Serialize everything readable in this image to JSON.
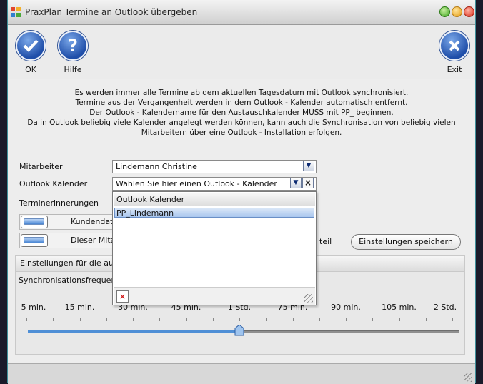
{
  "window": {
    "title": "PraxPlan Termine an Outlook übergeben"
  },
  "toolbar": {
    "ok_label": "OK",
    "help_label": "Hilfe",
    "exit_label": "Exit"
  },
  "info_lines": [
    "Es werden immer alle Termine ab dem aktuellen Tagesdatum mit Outlook synchronisiert.",
    "Termine aus der Vergangenheit  werden in dem  Outlook - Kalender automatisch entfernt.",
    "Der Outlook - Kalendername für den Austauschkalender MUSS mit  PP_ beginnen.",
    "Da in Outlook beliebig viele Kalender angelegt werden können, kann auch die Synchronisation von beliebig vielen",
    "Mitarbeitern über eine Outlook - Installation erfolgen."
  ],
  "form": {
    "mitarbeiter_label": "Mitarbeiter",
    "mitarbeiter_value": "Lindemann Christine",
    "kalender_label": "Outlook Kalender",
    "kalender_value": "Wählen Sie hier einen Outlook - Kalender",
    "terminerinnerungen_label": "Terminerinnerungen",
    "kundendaten_label": "Kundendate",
    "dieser_label": "Dieser Mita",
    "teil_label": "teil",
    "save_label": "Einstellungen speichern"
  },
  "popup": {
    "header": "Outlook Kalender",
    "items": [
      "PP_Lindemann"
    ]
  },
  "panel": {
    "title": "Einstellungen für die aut",
    "freq_label": "Synchronisationsfrequenz",
    "ticks": [
      "5 min.",
      "15 min.",
      "30 min.",
      "45 min.",
      "1 Std.",
      "75 min.",
      "90 min.",
      "105 min.",
      "2 Std."
    ],
    "slider_value": "1 Std."
  },
  "colors": {
    "accent": "#4a86d4",
    "titlebar": "#dcdcdc",
    "delete": "#d01a1a"
  }
}
